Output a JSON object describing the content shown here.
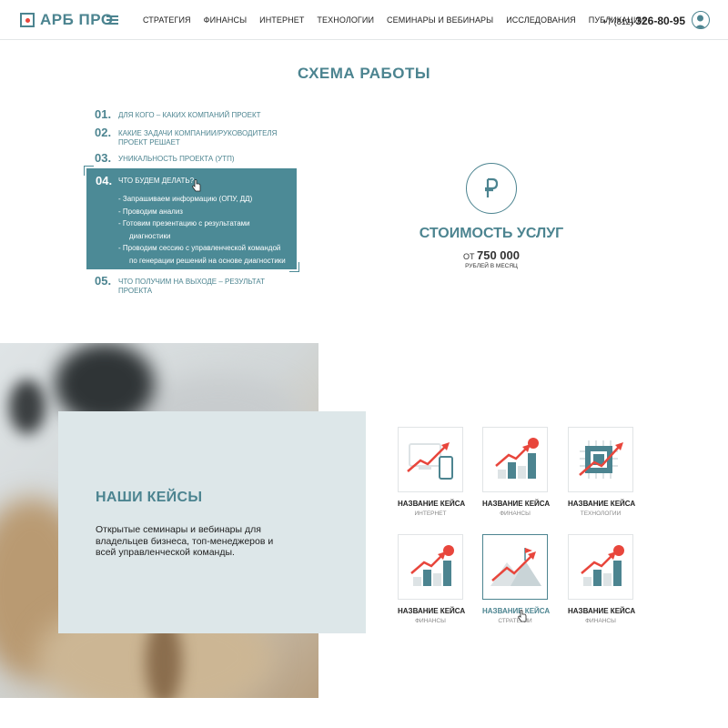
{
  "header": {
    "logo_text": "АРБ ПРО",
    "nav": [
      "СТРАТЕГИЯ",
      "ФИНАНСЫ",
      "ИНТЕРНЕТ",
      "ТЕХНОЛОГИИ",
      "СЕМИНАРЫ И ВЕБИНАРЫ",
      "ИССЛЕДОВАНИЯ",
      "ПУБЛИКАЦИИ"
    ],
    "phone_prefix": "+7 (812)",
    "phone_number": "326-80-95"
  },
  "scheme": {
    "title": "СХЕМА РАБОТЫ",
    "steps": [
      {
        "num": "01.",
        "text": "ДЛЯ КОГО – КАКИХ КОМПАНИЙ ПРОЕКТ"
      },
      {
        "num": "02.",
        "text": "КАКИЕ ЗАДАЧИ КОМПАНИИ/РУКОВОДИТЕЛЯ ПРОЕКТ РЕШАЕТ"
      },
      {
        "num": "03.",
        "text": "УНИКАЛЬНОСТЬ ПРОЕКТА (УТП)"
      },
      {
        "num": "05.",
        "text": "ЧТО ПОЛУЧИМ НА ВЫХОДЕ – РЕЗУЛЬТАТ ПРОЕКТА"
      }
    ],
    "active_step": {
      "num": "04.",
      "title": "ЧТО БУДЕМ ДЕЛАТЬ?",
      "items": [
        "- Запрашиваем информацию (ОПУ, ДД)",
        "- Проводим анализ",
        "- Готовим презентацию с результатами",
        "  диагностики",
        "- Проводим сессию с управленческой командой",
        "  по генерации решений на основе диагностики"
      ]
    }
  },
  "price": {
    "icon": "ruble-icon",
    "title": "СТОИМОСТЬ УСЛУГ",
    "from_label": "ОТ",
    "amount": "750 000",
    "period": "РУБЛЕЙ В МЕСЯЦ"
  },
  "cases": {
    "title": "НАШИ КЕЙСЫ",
    "description": "Открытые семинары и вебинары для владельцев бизнеса, топ-менеджеров и всей управленческой команды.",
    "items": [
      {
        "name": "НАЗВАНИЕ КЕЙСА",
        "category": "ИНТЕРНЕТ",
        "icon": "devices-growth-icon"
      },
      {
        "name": "НАЗВАНИЕ КЕЙСА",
        "category": "ФИНАНСЫ",
        "icon": "bar-growth-icon"
      },
      {
        "name": "НАЗВАНИЕ КЕЙСА",
        "category": "ТЕХНОЛОГИИ",
        "icon": "chip-growth-icon"
      },
      {
        "name": "НАЗВАНИЕ КЕЙСА",
        "category": "ФИНАНСЫ",
        "icon": "bar-growth-icon"
      },
      {
        "name": "НАЗВАНИЕ КЕЙСА",
        "category": "СТРАТЕГИИ",
        "icon": "mountain-growth-icon"
      },
      {
        "name": "НАЗВАНИЕ КЕЙСА",
        "category": "ФИНАНСЫ",
        "icon": "bar-growth-icon"
      }
    ]
  },
  "colors": {
    "accent": "#4c8490",
    "accent_dark": "#4c8a96",
    "red": "#e8463c",
    "panel": "#dde7e9"
  }
}
